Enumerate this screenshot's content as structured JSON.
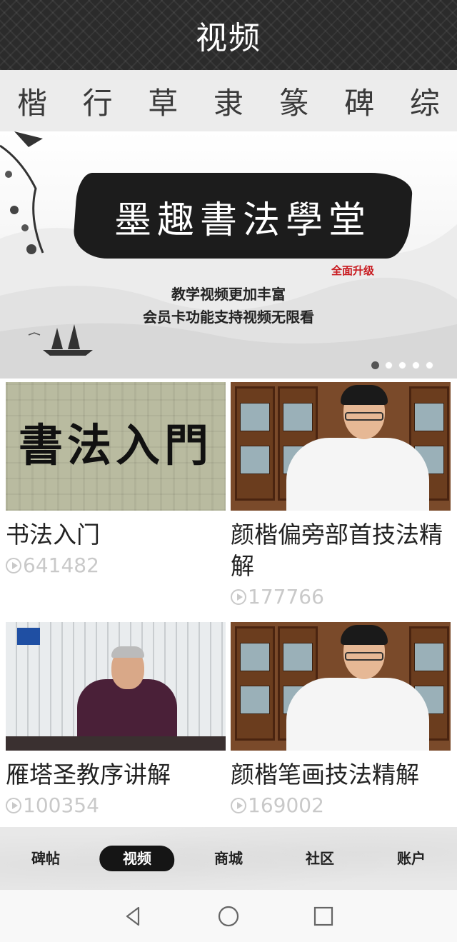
{
  "header": {
    "title": "视频"
  },
  "tabs": [
    "楷",
    "行",
    "草",
    "隶",
    "篆",
    "碑",
    "综"
  ],
  "banner": {
    "title": "墨趣書法學堂",
    "badge": "全面升级",
    "line1": "教学视频更加丰富",
    "line2": "会员卡功能支持视频无限看",
    "dot_count": 5,
    "active_dot": 0
  },
  "videos": [
    {
      "title": "书法入门",
      "views": "641482",
      "thumb_text": "書法入門"
    },
    {
      "title": "颜楷偏旁部首技法精解",
      "views": "177766"
    },
    {
      "title": "雁塔圣教序讲解",
      "views": "100354"
    },
    {
      "title": "颜楷笔画技法精解",
      "views": "169002"
    }
  ],
  "bottom_nav": {
    "items": [
      "碑帖",
      "视频",
      "商城",
      "社区",
      "账户"
    ],
    "active_index": 1
  },
  "system_nav": {
    "icons": [
      "back-icon",
      "home-icon",
      "recents-icon"
    ]
  }
}
